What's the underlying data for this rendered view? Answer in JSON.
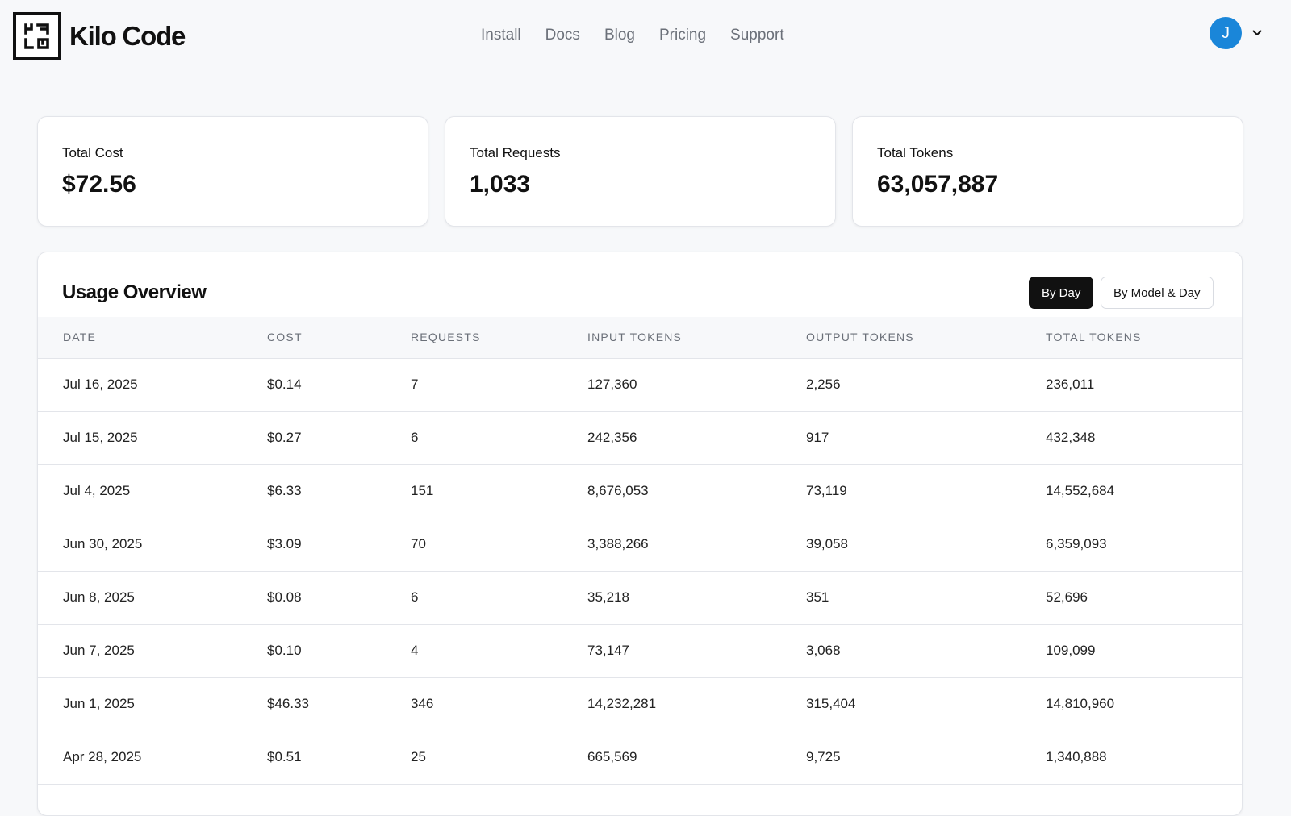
{
  "brand": {
    "name": "Kilo Code"
  },
  "nav": [
    "Install",
    "Docs",
    "Blog",
    "Pricing",
    "Support"
  ],
  "user": {
    "initial": "J"
  },
  "stats": [
    {
      "label": "Total Cost",
      "value": "$72.56"
    },
    {
      "label": "Total Requests",
      "value": "1,033"
    },
    {
      "label": "Total Tokens",
      "value": "63,057,887"
    }
  ],
  "usage": {
    "title": "Usage Overview",
    "toggles": {
      "by_day": "By Day",
      "by_model_day": "By Model & Day",
      "active": "by_day"
    },
    "columns": [
      "DATE",
      "COST",
      "REQUESTS",
      "INPUT TOKENS",
      "OUTPUT TOKENS",
      "TOTAL TOKENS"
    ],
    "rows": [
      [
        "Jul 16, 2025",
        "$0.14",
        "7",
        "127,360",
        "2,256",
        "236,011"
      ],
      [
        "Jul 15, 2025",
        "$0.27",
        "6",
        "242,356",
        "917",
        "432,348"
      ],
      [
        "Jul 4, 2025",
        "$6.33",
        "151",
        "8,676,053",
        "73,119",
        "14,552,684"
      ],
      [
        "Jun 30, 2025",
        "$3.09",
        "70",
        "3,388,266",
        "39,058",
        "6,359,093"
      ],
      [
        "Jun 8, 2025",
        "$0.08",
        "6",
        "35,218",
        "351",
        "52,696"
      ],
      [
        "Jun 7, 2025",
        "$0.10",
        "4",
        "73,147",
        "3,068",
        "109,099"
      ],
      [
        "Jun 1, 2025",
        "$46.33",
        "346",
        "14,232,281",
        "315,404",
        "14,810,960"
      ],
      [
        "Apr 28, 2025",
        "$0.51",
        "25",
        "665,569",
        "9,725",
        "1,340,888"
      ]
    ]
  },
  "colors": {
    "background": "#f7f8fa",
    "avatar": "#1a86d9",
    "active_toggle": "#111111",
    "muted_text": "#6b7079"
  },
  "icons": {
    "logo": "kilo-logo-icon",
    "chevron": "chevron-down-icon"
  }
}
